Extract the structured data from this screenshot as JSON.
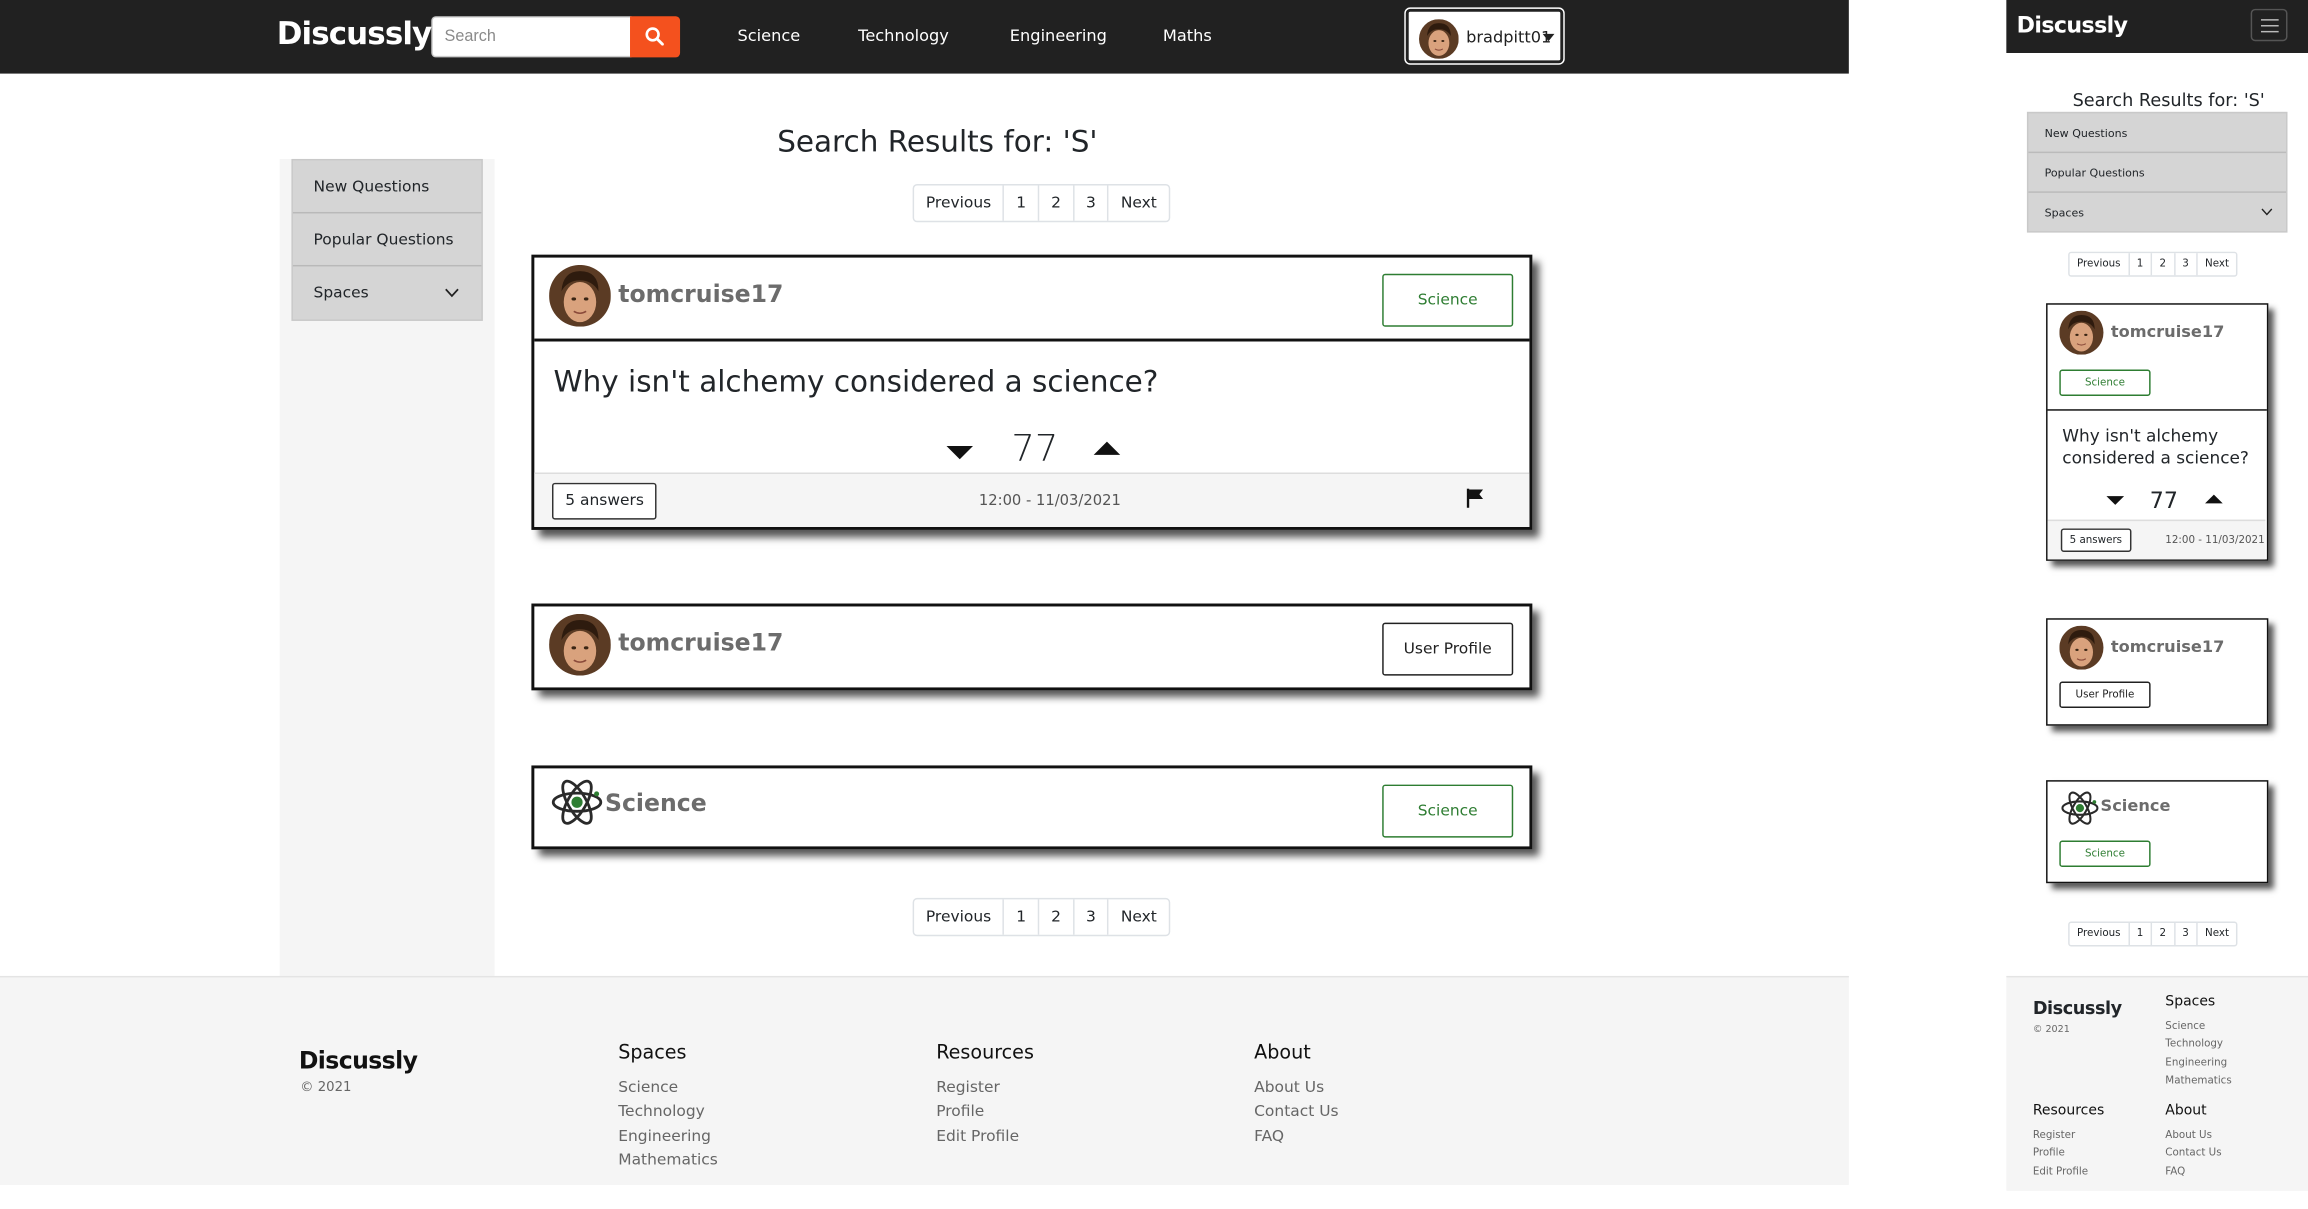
{
  "app": {
    "logo": "Discussly"
  },
  "header": {
    "search_placeholder": "Search",
    "nav": [
      "Science",
      "Technology",
      "Engineering",
      "Maths"
    ],
    "user": "bradpitt01"
  },
  "sidebar": {
    "items": [
      "New Questions",
      "Popular Questions",
      "Spaces"
    ]
  },
  "results": {
    "title": "Search Results for: 'S'"
  },
  "pagination": {
    "prev": "Previous",
    "pages": [
      "1",
      "2",
      "3"
    ],
    "next": "Next"
  },
  "question_card": {
    "username": "tomcruise17",
    "tag": "Science",
    "question": "Why isn't alchemy considered a science?",
    "votes": "77",
    "answers": "5 answers",
    "timestamp": "12:00 - 11/03/2021"
  },
  "user_card": {
    "username": "tomcruise17",
    "button": "User Profile"
  },
  "space_card": {
    "name": "Science",
    "tag": "Science"
  },
  "footer": {
    "logo": "Discussly",
    "copyright": "© 2021",
    "spaces": {
      "heading": "Spaces",
      "links": [
        "Science",
        "Technology",
        "Engineering",
        "Mathematics"
      ]
    },
    "resources": {
      "heading": "Resources",
      "links": [
        "Register",
        "Profile",
        "Edit Profile"
      ]
    },
    "about": {
      "heading": "About",
      "links": [
        "About Us",
        "Contact Us",
        "FAQ"
      ]
    }
  },
  "colors": {
    "navbar": "#212121",
    "search_button": "#f4511e",
    "tag_green": "#2e7d32",
    "sidebar": "#d5d5d5",
    "footer": "#f5f5f5"
  }
}
